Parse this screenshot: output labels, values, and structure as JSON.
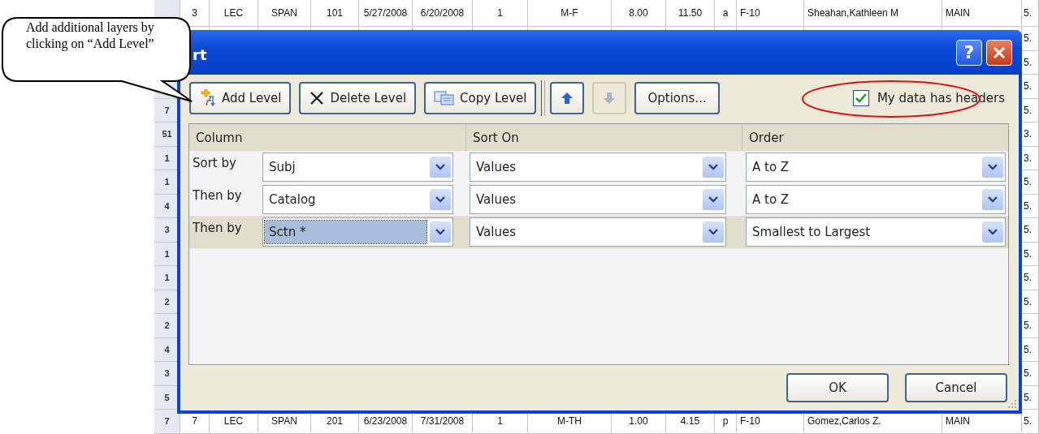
{
  "spreadsheet": {
    "rows": [
      {
        "cells": [
          "3",
          "LEC",
          "SPAN",
          "101",
          "5/27/2008",
          "6/20/2008",
          "1",
          "M-F",
          "8.00",
          "11.50",
          "a",
          "F-10",
          "Sheahan,Kathleen M",
          "MAIN"
        ],
        "edge": "5."
      },
      {
        "edge": "5."
      },
      {
        "edge": "5."
      },
      {
        "edge": "5."
      },
      {
        "row_number": "7",
        "edge": "5."
      },
      {
        "row_number": "51",
        "edge": "3."
      },
      {
        "row_number": "1",
        "edge": "3."
      },
      {
        "row_number": "1",
        "edge": "5."
      },
      {
        "row_number": "4",
        "edge": "5."
      },
      {
        "row_number": "3",
        "edge": "5."
      },
      {
        "row_number": "1",
        "edge": "5."
      },
      {
        "row_number": "1",
        "edge": "5."
      },
      {
        "row_number": "2",
        "edge": "5."
      },
      {
        "row_number": "2",
        "edge": "5."
      },
      {
        "row_number": "4",
        "edge": "5."
      },
      {
        "row_number": "3",
        "edge": "5."
      },
      {
        "row_number": "5",
        "edge": "5."
      },
      {
        "row_number": "7",
        "cells": [
          "7",
          "LEC",
          "SPAN",
          "201",
          "6/23/2008",
          "7/31/2008",
          "1",
          "M-TH",
          "1.00",
          "4.15",
          "p",
          "F-10",
          "Gomez,Carlos Z.",
          "MAIN"
        ],
        "edge": "5."
      }
    ]
  },
  "dialog": {
    "title": "rt",
    "help_button": "?",
    "toolbar": [
      {
        "label": "Add Level"
      },
      {
        "label": "Delete Level"
      },
      {
        "label": "Copy Level"
      }
    ],
    "move_buttons": [
      {
        "kind": "up",
        "disabled": false
      },
      {
        "kind": "down",
        "disabled": true
      }
    ],
    "options_button": "Options...",
    "headers_checkbox": {
      "label": "My data has headers",
      "checked": true
    },
    "columns": [
      "Column",
      "Sort On",
      "Order"
    ],
    "levels": [
      {
        "label": "Sort by",
        "column": "Subj",
        "sort_on": "Values",
        "order": "A to Z",
        "selected": false
      },
      {
        "label": "Then by",
        "column": "Catalog",
        "sort_on": "Values",
        "order": "A to Z",
        "selected": false
      },
      {
        "label": "Then by",
        "column": "Sctn *",
        "sort_on": "Values",
        "order": "Smallest to Largest",
        "selected": true
      }
    ],
    "buttons": [
      "OK",
      "Cancel"
    ]
  },
  "callout": {
    "text": "Add additional layers by clicking on “Add Level”"
  }
}
